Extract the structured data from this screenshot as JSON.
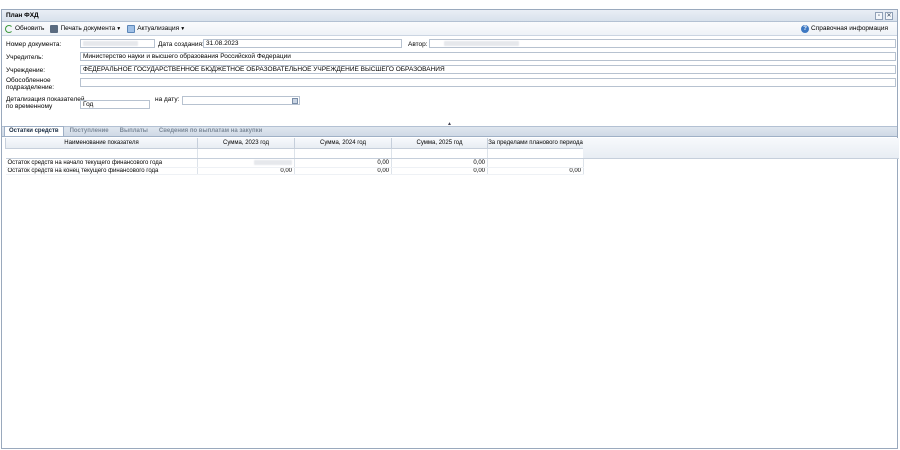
{
  "window": {
    "title": "План ФХД"
  },
  "toolbar": {
    "refresh_label": "Обновить",
    "print_label": "Печать документа",
    "update_label": "Актуализация",
    "help_label": "Справочная информация"
  },
  "form": {
    "doc_number_label": "Номер документа:",
    "created_date_label": "Дата создания:",
    "created_date_value": "31.08.2023",
    "author_label": "Автор:",
    "founder_label": "Учредитель:",
    "founder_value": "Министерство науки и высшего образования Российской Федерации",
    "institution_label": "Учреждение:",
    "institution_value": "ФЕДЕРАЛЬНОЕ ГОСУДАРСТВЕННОЕ БЮДЖЕТНОЕ ОБРАЗОВАТЕЛЬНОЕ УЧРЕЖДЕНИЕ ВЫСШЕГО ОБРАЗОВАНИЯ",
    "subdivision_label_1": "Обособленное",
    "subdivision_label_2": "подразделение:",
    "detail_label_1": "Детализация показателей",
    "detail_label_2": "по временному",
    "detail_value": "Год",
    "on_date_label": "на дату:"
  },
  "tabs": [
    {
      "label": "Остатки средств",
      "active": true
    },
    {
      "label": "Поступление",
      "active": false
    },
    {
      "label": "Выплаты",
      "active": false
    },
    {
      "label": "Сведения по выплатам на закупки",
      "active": false
    }
  ],
  "table": {
    "columns": [
      "Наименование показателя",
      "Сумма, 2023 год",
      "Сумма, 2024 год",
      "Сумма, 2025 год",
      "За пределами планового периода"
    ],
    "rows": [
      {
        "name": "Остаток средств на начало текущего финансового года",
        "y2023": "",
        "y2024": "0,00",
        "y2025": "0,00",
        "beyond": ""
      },
      {
        "name": "Остаток средств на конец текущего финансового года",
        "y2023": "0,00",
        "y2024": "0,00",
        "y2025": "0,00",
        "beyond": "0,00"
      }
    ]
  }
}
